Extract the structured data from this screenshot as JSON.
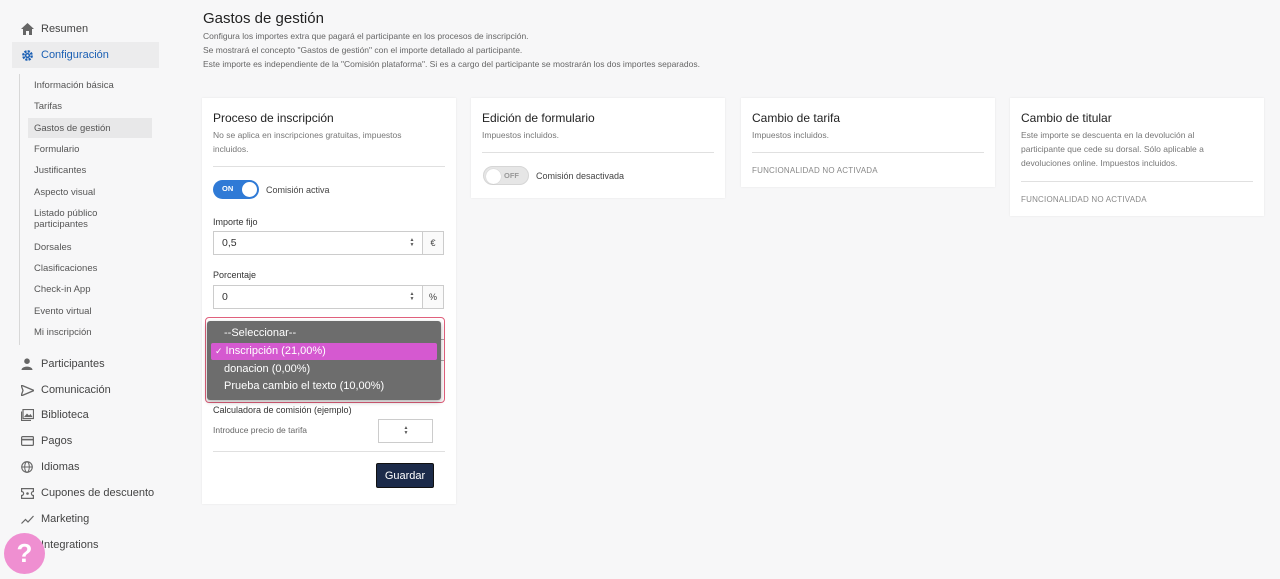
{
  "sidebar": {
    "top_items": [
      {
        "label": "Resumen",
        "icon": "home-icon"
      },
      {
        "label": "Configuración",
        "icon": "gear-icon"
      }
    ],
    "sub_items": [
      "Información básica",
      "Tarifas",
      "Gastos de gestión",
      "Formulario",
      "Justificantes",
      "Aspecto visual",
      "Listado público participantes",
      "Dorsales",
      "Clasificaciones",
      "Check-in App",
      "Evento virtual",
      "Mi inscripción"
    ],
    "bottom_items": [
      {
        "label": "Participantes",
        "icon": "person-icon"
      },
      {
        "label": "Comunicación",
        "icon": "send-icon"
      },
      {
        "label": "Biblioteca",
        "icon": "image-icon"
      },
      {
        "label": "Pagos",
        "icon": "card-icon"
      },
      {
        "label": "Idiomas",
        "icon": "globe-icon"
      },
      {
        "label": "Cupones de descuento",
        "icon": "ticket-icon"
      },
      {
        "label": "Marketing",
        "icon": "trend-icon"
      },
      {
        "label": "Integrations",
        "icon": "plug-icon"
      }
    ],
    "help_label": "?"
  },
  "header": {
    "title": "Gastos de gestión",
    "lines": [
      "Configura los importes extra que pagará el participante en los procesos de inscripción.",
      "Se mostrará el concepto \"Gastos de gestión\" con el importe detallado al participante.",
      "Este importe es independiente de la \"Comisión plataforma\". Si es a cargo del participante se mostrarán los dos importes separados."
    ]
  },
  "cards": {
    "inscripcion": {
      "title": "Proceso de inscripción",
      "subtitle": "No se aplica en inscripciones gratuitas, impuestos incluidos.",
      "toggle_label": "ON",
      "toggle_text": "Comisión activa",
      "fixed_label": "Importe fijo",
      "fixed_value": "0,5",
      "fixed_unit": "€",
      "percent_label": "Porcentaje",
      "percent_value": "0",
      "percent_unit": "%",
      "tax_options": [
        "--Seleccionar--",
        "Inscripción (21,00%)",
        "donacion (0,00%)",
        "Prueba cambio el texto (10,00%)"
      ],
      "tax_selected": "Inscripción (21,00%)",
      "calc_title": "Calculadora de comisión (ejemplo)",
      "calc_text": "Introduce precio de tarifa",
      "save_label": "Guardar"
    },
    "formulario": {
      "title": "Edición de formulario",
      "subtitle": "Impuestos incluidos.",
      "toggle_label": "OFF",
      "toggle_text": "Comisión desactivada"
    },
    "tarifa": {
      "title": "Cambio de tarifa",
      "subtitle": "Impuestos incluidos.",
      "status": "FUNCIONALIDAD NO ACTIVADA"
    },
    "titular": {
      "title": "Cambio de titular",
      "subtitle_lines": [
        "Este importe se descuenta en la devolución al",
        "participante que cede su dorsal. Sólo aplicable a",
        "devoluciones online. Impuestos incluidos."
      ],
      "status": "FUNCIONALIDAD NO ACTIVADA"
    }
  },
  "colors": {
    "accent": "#1a5fb4",
    "toggle_on": "#2f7ad6",
    "dropdown_selected": "#d559d0",
    "save_button": "#1c2b4a",
    "help_button": "#ef8fd1"
  }
}
